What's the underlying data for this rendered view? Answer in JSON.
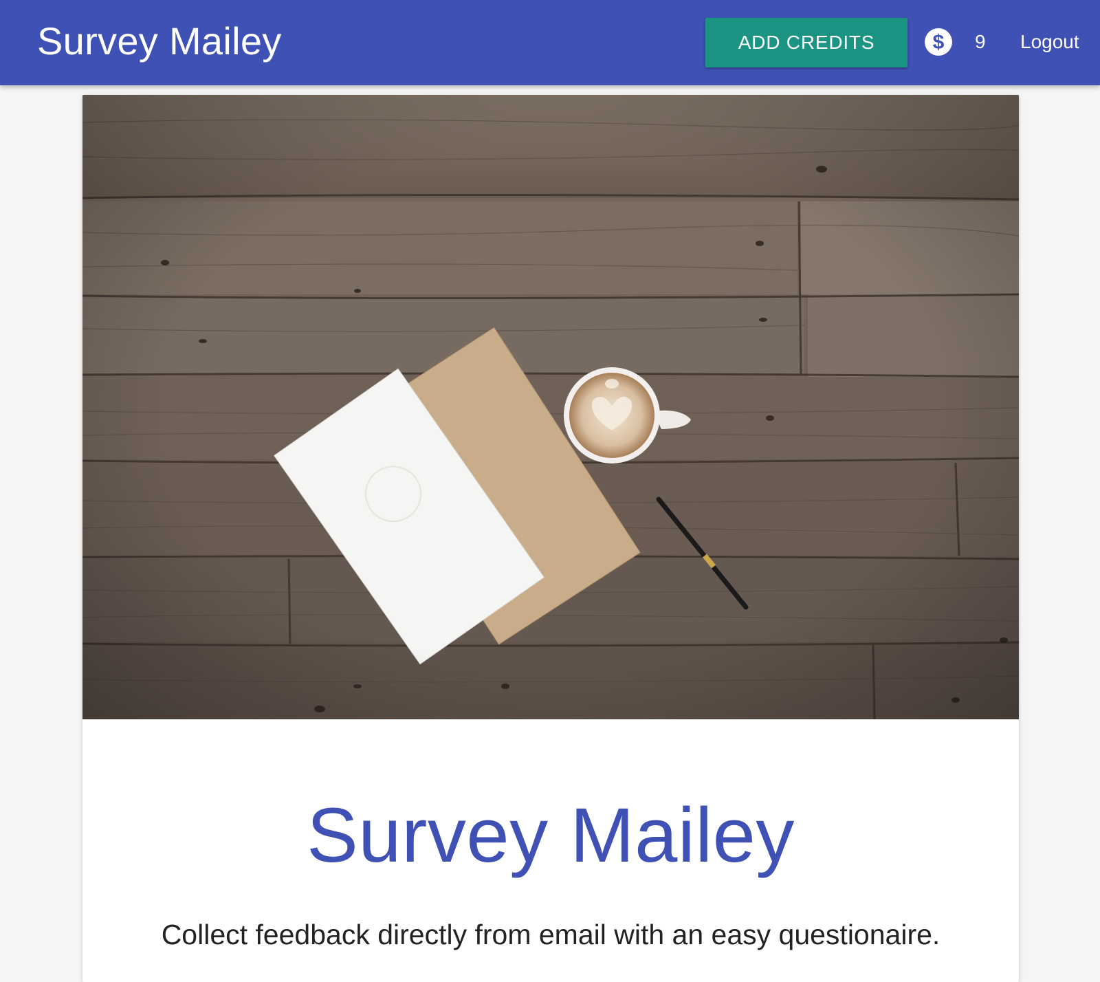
{
  "navbar": {
    "brand": "Survey Mailey",
    "add_credits_label": "ADD CREDITS",
    "credits_icon": "dollar-circle-icon",
    "credits_count": "9",
    "logout_label": "Logout"
  },
  "hero": {
    "image": "photo-of-notebooks-coffee-pen-on-wooden-table",
    "title": "Survey Mailey",
    "subtitle": "Collect feedback directly from email with an easy questionaire."
  },
  "colors": {
    "primary": "#3f51b5",
    "accent": "#1b9483",
    "background": "#f5f5f5"
  }
}
